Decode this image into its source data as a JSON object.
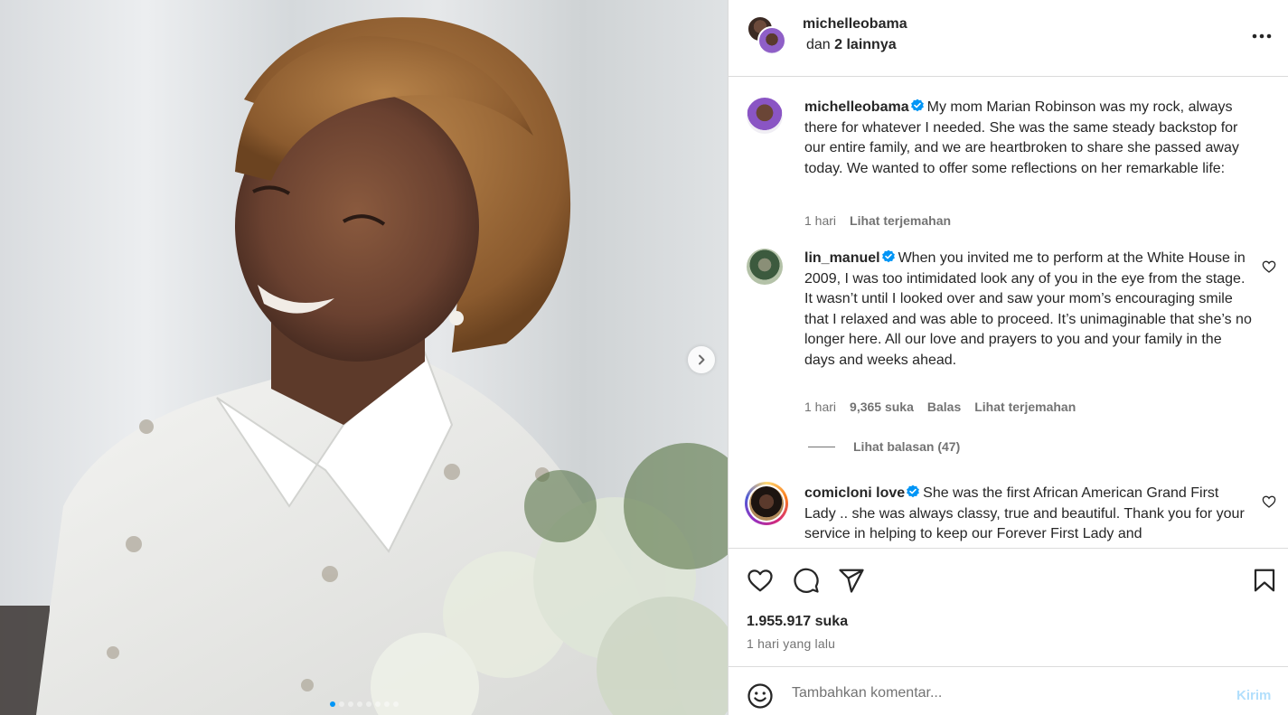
{
  "post": {
    "author": "michelleobama",
    "collab_prefix": "dan ",
    "collab_count": "2 lainnya"
  },
  "carousel": {
    "slide_count": 8,
    "active_index": 0
  },
  "comments": [
    {
      "user": "michelleobama",
      "verified": true,
      "text": "My mom Marian Robinson was my rock, always there for whatever I needed. She was the same steady backstop for our entire family, and we are heartbroken to share she passed away today. We wanted to offer some reflections on her remarkable life:",
      "time": "1 hari",
      "translate": "Lihat terjemahan"
    },
    {
      "user": "lin_manuel",
      "verified": true,
      "text": "When you invited me to perform at the White House in 2009, I was too intimidated look any of you in the eye from the stage. It wasn’t until I looked over and saw your mom’s encouraging smile that I relaxed and was able to proceed. It’s unimaginable that she’s no longer here. All our love and prayers to you and your family in the days and weeks ahead.",
      "time": "1 hari",
      "likes": "9,365 suka",
      "reply": "Balas",
      "translate": "Lihat terjemahan",
      "view_replies": "Lihat balasan (47)"
    },
    {
      "user": "comicloni love",
      "verified": true,
      "text": "She was the first African American Grand First Lady .. she was always classy, true and beautiful. Thank you for your service in helping to keep our Forever First Lady and"
    }
  ],
  "stats": {
    "likes": "1.955.917 suka",
    "posted": "1 hari yang lalu"
  },
  "composer": {
    "placeholder": "Tambahkan komentar...",
    "send": "Kirim"
  },
  "colors": {
    "verified": "#0095f6",
    "active_dot": "#0095f6",
    "send_disabled": "#b2dffc"
  },
  "icons": [
    "more-icon",
    "chevron-right-icon",
    "verified-icon",
    "heart-icon",
    "comment-icon",
    "share-icon",
    "bookmark-icon",
    "emoji-icon"
  ]
}
